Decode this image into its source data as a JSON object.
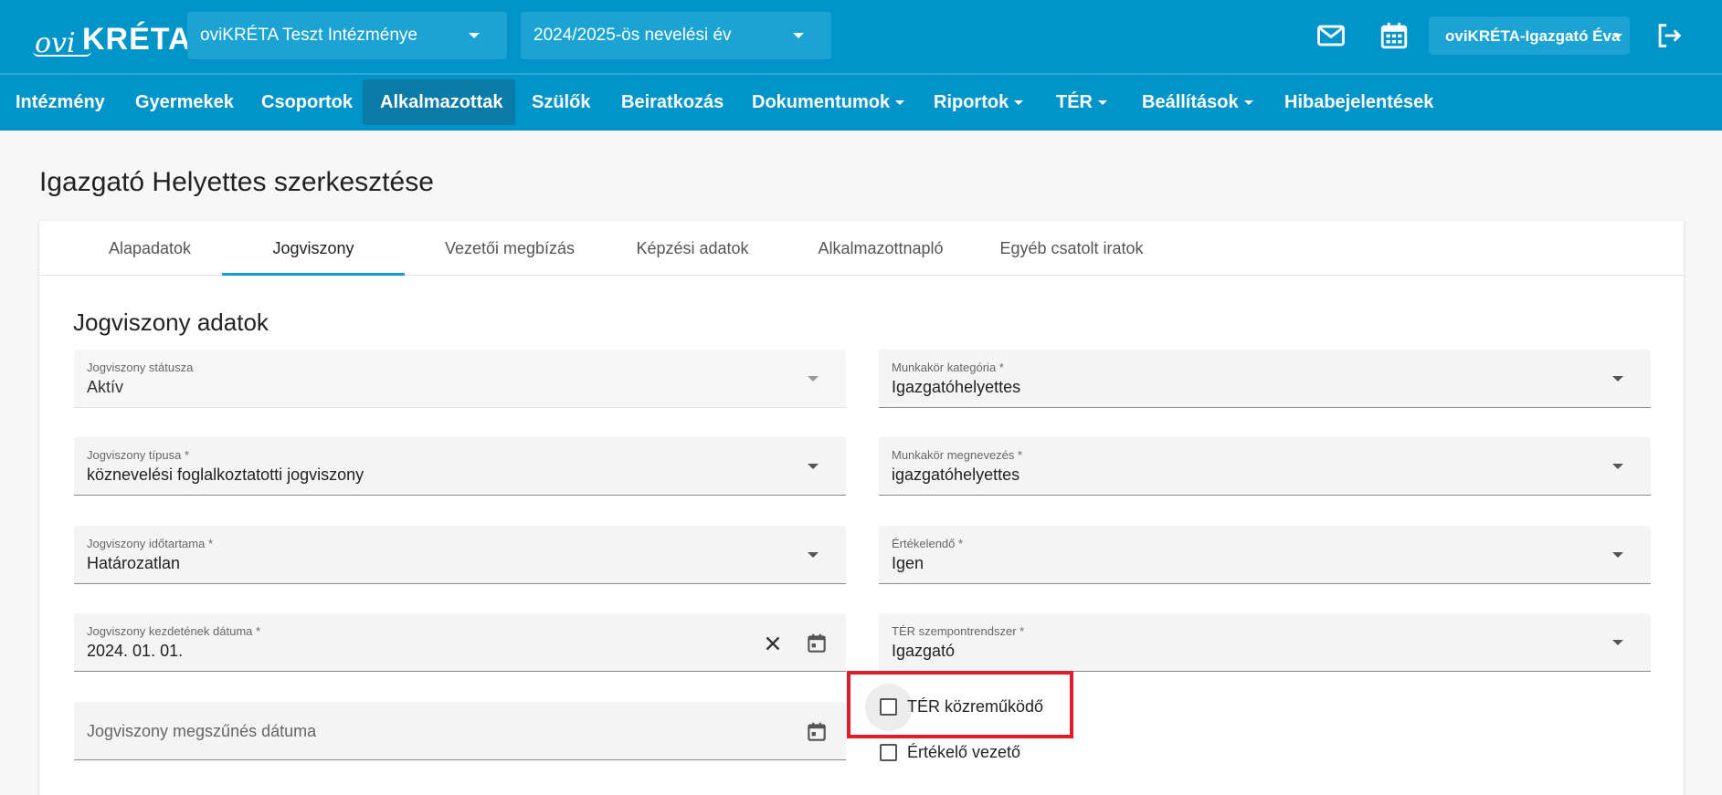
{
  "header": {
    "logo_ovi": "ovi",
    "logo_kreta": "KRÉTA",
    "institution": "oviKRÉTA Teszt Intézménye",
    "school_year": "2024/2025-ös nevelési év",
    "user": "oviKRÉTA-Igazgató Éva",
    "icons": [
      "mail-icon",
      "calendar-icon",
      "logout-icon"
    ]
  },
  "nav": {
    "items": [
      {
        "label": "Intézmény"
      },
      {
        "label": "Gyermekek"
      },
      {
        "label": "Csoportok"
      },
      {
        "label": "Alkalmazottak"
      },
      {
        "label": "Szülők"
      },
      {
        "label": "Beiratkozás"
      },
      {
        "label": "Dokumentumok"
      },
      {
        "label": "Riportok"
      },
      {
        "label": "TÉR"
      },
      {
        "label": "Beállítások"
      },
      {
        "label": "Hibabejelentések"
      }
    ],
    "active": "Alkalmazottak"
  },
  "page": {
    "title": "Igazgató Helyettes szerkesztése"
  },
  "tabs": {
    "items": [
      {
        "label": "Alapadatok"
      },
      {
        "label": "Jogviszony"
      },
      {
        "label": "Vezetői megbízás"
      },
      {
        "label": "Képzési adatok"
      },
      {
        "label": "Alkalmazottnapló"
      },
      {
        "label": "Egyéb csatolt iratok"
      }
    ],
    "active": "Jogviszony"
  },
  "section": {
    "title": "Jogviszony adatok"
  },
  "form": {
    "left": [
      {
        "label": "Jogviszony státusza",
        "value": "Aktív"
      },
      {
        "label": "Jogviszony típusa *",
        "value": "köznevelési foglalkoztatotti jogviszony"
      },
      {
        "label": "Jogviszony időtartama *",
        "value": "Határozatlan"
      },
      {
        "label": "Jogviszony kezdetének dátuma *",
        "value": "2024. 01. 01."
      },
      {
        "placeholder": "Jogviszony megszűnés dátuma"
      }
    ],
    "right": [
      {
        "label": "Munkakör kategória *",
        "value": "Igazgatóhelyettes"
      },
      {
        "label": "Munkakör megnevezés *",
        "value": "igazgatóhelyettes"
      },
      {
        "label": "Értékelendő *",
        "value": "Igen"
      },
      {
        "label": "TÉR szempontrendszer *",
        "value": "Igazgató"
      }
    ],
    "checkboxes": [
      {
        "label": "TÉR közreműködő",
        "checked": false
      },
      {
        "label": "Értékelő vezető",
        "checked": false
      }
    ]
  },
  "colors": {
    "primary": "#0094c8",
    "nav_active": "#0a7aa6",
    "tab_underline": "#1a9bd0",
    "highlight": "#e01e2a"
  }
}
